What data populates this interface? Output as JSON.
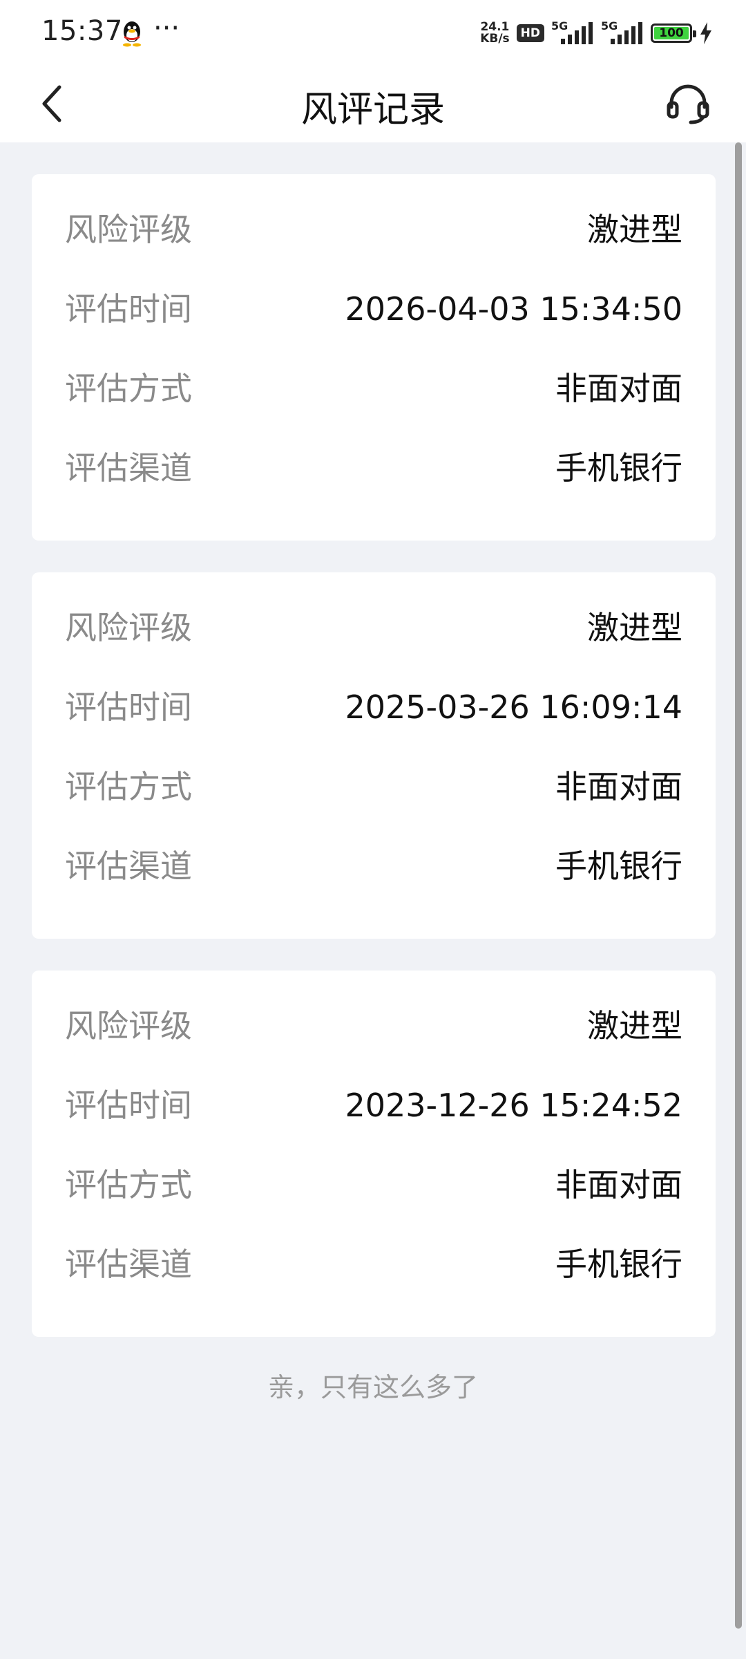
{
  "status_bar": {
    "time": "15:37",
    "more": "···",
    "net_speed_value": "24.1",
    "net_speed_unit": "KB/s",
    "hd_label": "HD",
    "signal1_label": "5G",
    "signal2_label": "5G",
    "battery_level": "100"
  },
  "nav": {
    "title": "风评记录"
  },
  "records": [
    {
      "rows": [
        {
          "label": "风险评级",
          "value": "激进型"
        },
        {
          "label": "评估时间",
          "value": "2026-04-03 15:34:50"
        },
        {
          "label": "评估方式",
          "value": "非面对面"
        },
        {
          "label": "评估渠道",
          "value": "手机银行"
        }
      ]
    },
    {
      "rows": [
        {
          "label": "风险评级",
          "value": "激进型"
        },
        {
          "label": "评估时间",
          "value": "2025-03-26 16:09:14"
        },
        {
          "label": "评估方式",
          "value": "非面对面"
        },
        {
          "label": "评估渠道",
          "value": "手机银行"
        }
      ]
    },
    {
      "rows": [
        {
          "label": "风险评级",
          "value": "激进型"
        },
        {
          "label": "评估时间",
          "value": "2023-12-26 15:24:52"
        },
        {
          "label": "评估方式",
          "value": "非面对面"
        },
        {
          "label": "评估渠道",
          "value": "手机银行"
        }
      ]
    }
  ],
  "footer_note": "亲，只有这么多了",
  "icons": {
    "back": "chevron-left-icon",
    "service": "headset-icon",
    "qq": "qq-penguin-icon"
  },
  "colors": {
    "background": "#f0f2f6",
    "card": "#ffffff",
    "label": "#8a8a8a",
    "value": "#111111",
    "battery": "#3fd33f"
  }
}
